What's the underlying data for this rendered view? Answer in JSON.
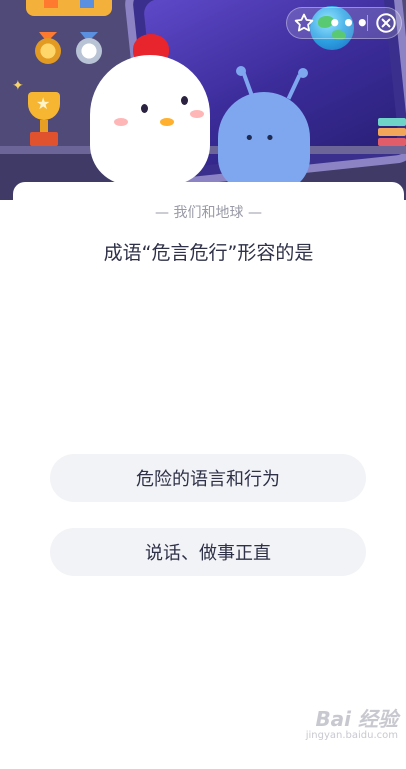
{
  "header": {
    "icons": [
      "star-icon",
      "more-icon",
      "close-icon",
      "globe-icon"
    ],
    "more_label": "•••"
  },
  "quiz": {
    "subtitle": "— 我们和地球 —",
    "question": "成语“危言危行”形容的是",
    "options": [
      "危险的语言和行为",
      "说话、做事正直"
    ]
  },
  "watermark": {
    "main": "Bai 经验",
    "sub": "jingyan.baidu.com"
  },
  "colors": {
    "hero_bg": "#4f4a78",
    "card_bg": "#ffffff",
    "option_bg": "#f2f3f6",
    "text_primary": "#2e3148",
    "text_secondary": "#9a9aa8"
  }
}
